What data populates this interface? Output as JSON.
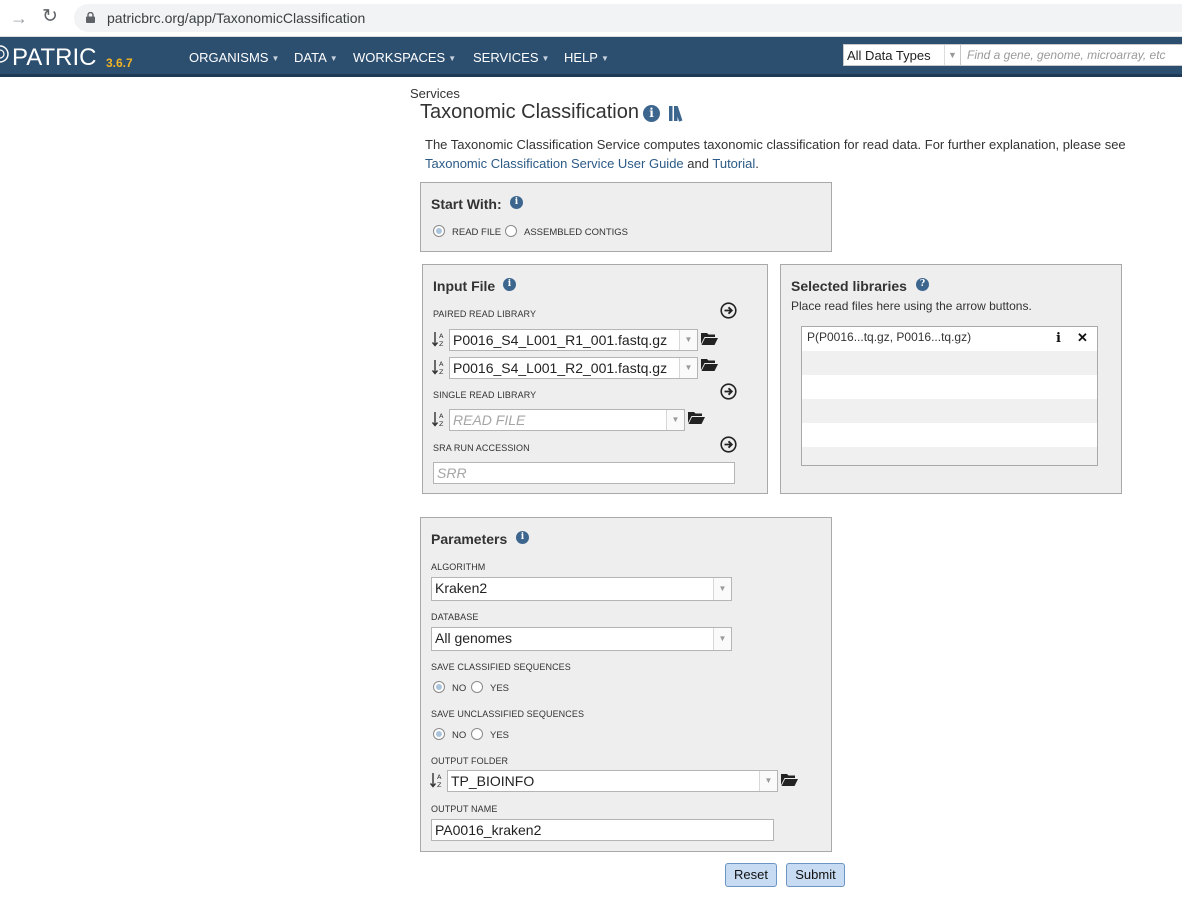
{
  "browser": {
    "url": "patricbrc.org/app/TaxonomicClassification"
  },
  "header": {
    "logo": "PATRIC",
    "version": "3.6.7",
    "nav": [
      "ORGANISMS",
      "DATA",
      "WORKSPACES",
      "SERVICES",
      "HELP"
    ],
    "search_type": "All Data Types",
    "search_placeholder": "Find a gene, genome, microarray, etc"
  },
  "breadcrumb": "Services",
  "page": {
    "title": "Taxonomic Classification",
    "desc_text": "The Taxonomic Classification Service computes taxonomic classification for read data. For further explanation, please see",
    "guide_link": "Taxonomic Classification Service User Guide",
    "and_text": "and",
    "tutorial_link": "Tutorial",
    "period": "."
  },
  "start_with": {
    "title": "Start With:",
    "options": [
      "READ FILE",
      "ASSEMBLED CONTIGS"
    ],
    "selected": "READ FILE"
  },
  "input_file": {
    "title": "Input File",
    "paired_label": "PAIRED READ LIBRARY",
    "read1": "P0016_S4_L001_R1_001.fastq.gz",
    "read2": "P0016_S4_L001_R2_001.fastq.gz",
    "single_label": "SINGLE READ LIBRARY",
    "single_placeholder": "READ FILE",
    "sra_label": "SRA RUN ACCESSION",
    "sra_placeholder": "SRR"
  },
  "selected_libraries": {
    "title": "Selected libraries",
    "hint": "Place read files here using the arrow buttons.",
    "items": [
      "P(P0016...tq.gz, P0016...tq.gz)"
    ]
  },
  "parameters": {
    "title": "Parameters",
    "algorithm_label": "ALGORITHM",
    "algorithm": "Kraken2",
    "database_label": "DATABASE",
    "database": "All genomes",
    "save_classified_label": "SAVE CLASSIFIED SEQUENCES",
    "save_unclassified_label": "SAVE UNCLASSIFIED SEQUENCES",
    "no": "NO",
    "yes": "YES",
    "output_folder_label": "OUTPUT FOLDER",
    "output_folder": "TP_BIOINFO",
    "output_name_label": "OUTPUT NAME",
    "output_name": "PA0016_kraken2"
  },
  "buttons": {
    "reset": "Reset",
    "submit": "Submit"
  },
  "colors": {
    "nav_bg": "#2c4e6f",
    "accent": "#f0b323",
    "link": "#2b5a86",
    "button": "#c7dbf2"
  }
}
